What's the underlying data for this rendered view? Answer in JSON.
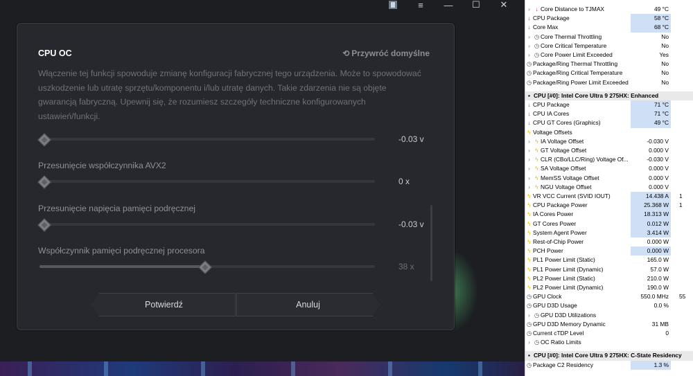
{
  "window": {
    "minimize": "—",
    "maximize": "☐",
    "close": "✕",
    "menu": "≡"
  },
  "dialog": {
    "title": "CPU OC",
    "reset_label": "Przywróć domyślne",
    "warning": "Włączenie tej funkcji spowoduje zmianę konfiguracji fabrycznej tego urządzenia. Może to spowodować uszkodzenie lub utratę sprzętu/komponentu i/lub utratę danych. Takie zdarzenia nie są objęte gwarancją fabryczną. Upewnij się, że rozumiesz szczegóły techniczne konfigurowanych ustawień/funkcji.",
    "settings": [
      {
        "label": "",
        "value": "-0.03 v",
        "fill": 0.0
      },
      {
        "label": "Przesunięcie współczynnika AVX2",
        "value": "0 x",
        "fill": 0.0
      },
      {
        "label": "Przesunięcie napięcia pamięci podręcznej",
        "value": "-0.03 v",
        "fill": 0.0
      },
      {
        "label": "Współczynnik pamięci podręcznej procesora",
        "value": "38 x",
        "fill": 0.49
      }
    ],
    "confirm_label": "Potwierdź",
    "cancel_label": "Anuluj"
  },
  "hwinfo": {
    "rows": [
      {
        "icon": "temp",
        "name": "Core Distance to TJMAX",
        "value": "49 °C",
        "indent": true,
        "hl": false
      },
      {
        "icon": "temp",
        "name": "CPU Package",
        "value": "58 °C",
        "hl": true
      },
      {
        "icon": "temp",
        "name": "Core Max",
        "value": "68 °C",
        "hl": true
      },
      {
        "icon": "clock",
        "name": "Core Thermal Throttling",
        "value": "No",
        "indent": true
      },
      {
        "icon": "clock",
        "name": "Core Critical Temperature",
        "value": "No",
        "indent": true
      },
      {
        "icon": "clock",
        "name": "Core Power Limit Exceeded",
        "value": "Yes",
        "indent": true
      },
      {
        "icon": "clock",
        "name": "Package/Ring Thermal Throttling",
        "value": "No"
      },
      {
        "icon": "clock",
        "name": "Package/Ring Critical Temperature",
        "value": "No"
      },
      {
        "icon": "clock",
        "name": "Package/Ring Power Limit Exceeded",
        "value": "No"
      }
    ],
    "section1": "CPU [#0]: Intel Core Ultra 9 275HX: Enhanced",
    "rows2": [
      {
        "icon": "temp",
        "name": "CPU Package",
        "value": "71 °C",
        "hl": true
      },
      {
        "icon": "temp",
        "name": "CPU IA Cores",
        "value": "71 °C",
        "hl": true
      },
      {
        "icon": "temp",
        "name": "CPU GT Cores (Graphics)",
        "value": "49 °C",
        "hl": true
      },
      {
        "icon": "bolt",
        "name": "Voltage Offsets",
        "value": ""
      },
      {
        "icon": "bolt",
        "name": "IA Voltage Offset",
        "value": "-0.030 V",
        "indent": true
      },
      {
        "icon": "bolt",
        "name": "GT Voltage Offset",
        "value": "0.000 V",
        "indent": true
      },
      {
        "icon": "bolt",
        "name": "CLR (CBo/LLC/Ring) Voltage Of...",
        "value": "-0.030 V",
        "indent": true
      },
      {
        "icon": "bolt",
        "name": "SA Voltage Offset",
        "value": "0.000 V",
        "indent": true
      },
      {
        "icon": "bolt",
        "name": "MemSS Voltage Offset",
        "value": "0.000 V",
        "indent": true
      },
      {
        "icon": "bolt",
        "name": "NGU Voltage Offset",
        "value": "0.000 V",
        "indent": true
      },
      {
        "icon": "bolt",
        "name": "VR VCC Current (SVID IOUT)",
        "value": "14.438 A",
        "hl": true,
        "v2": "1"
      },
      {
        "icon": "bolt",
        "name": "CPU Package Power",
        "value": "25.368 W",
        "hl": true,
        "v2": "1"
      },
      {
        "icon": "bolt",
        "name": "IA Cores Power",
        "value": "18.313 W",
        "hl": true
      },
      {
        "icon": "bolt",
        "name": "GT Cores Power",
        "value": "0.012 W",
        "hl": true
      },
      {
        "icon": "bolt",
        "name": "System Agent Power",
        "value": "3.414 W",
        "hl": true
      },
      {
        "icon": "bolt",
        "name": "Rest-of-Chip Power",
        "value": "0.000 W"
      },
      {
        "icon": "bolt",
        "name": "PCH Power",
        "value": "0.000 W",
        "hl": true
      },
      {
        "icon": "bolt",
        "name": "PL1 Power Limit (Static)",
        "value": "165.0 W"
      },
      {
        "icon": "bolt",
        "name": "PL1 Power Limit (Dynamic)",
        "value": "57.0 W"
      },
      {
        "icon": "bolt",
        "name": "PL2 Power Limit (Static)",
        "value": "210.0 W"
      },
      {
        "icon": "bolt",
        "name": "PL2 Power Limit (Dynamic)",
        "value": "190.0 W"
      },
      {
        "icon": "clock",
        "name": "GPU Clock",
        "value": "550.0 MHz",
        "v2": "55"
      },
      {
        "icon": "clock",
        "name": "GPU D3D Usage",
        "value": "0.0 %"
      },
      {
        "icon": "clock",
        "name": "GPU D3D Utilizations",
        "value": "",
        "indent": true
      },
      {
        "icon": "clock",
        "name": "GPU D3D Memory Dynamic",
        "value": "31 MB"
      },
      {
        "icon": "clock",
        "name": "Current cTDP Level",
        "value": "0"
      },
      {
        "icon": "clock",
        "name": "OC Ratio Limits",
        "value": "",
        "indent": true
      }
    ],
    "section2": "CPU [#0]: Intel Core Ultra 9 275HX: C-State Residency",
    "rows3": [
      {
        "icon": "clock",
        "name": "Package C2 Residency",
        "value": "1.3 %",
        "hl": true
      }
    ]
  }
}
